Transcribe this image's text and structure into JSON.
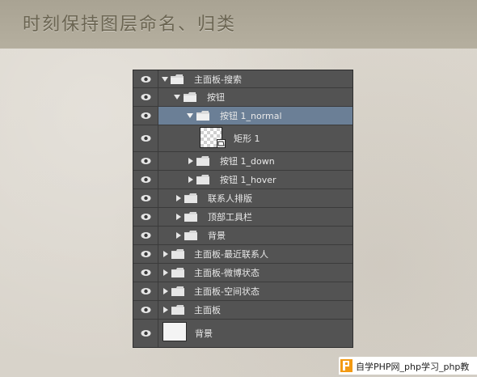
{
  "header": {
    "title": "时刻保持图层命名、归类"
  },
  "layers_panel": {
    "rows": [
      {
        "label": "主面板-搜索",
        "expanded": true,
        "type": "group"
      },
      {
        "label": "按钮",
        "expanded": true,
        "type": "group"
      },
      {
        "label": "按钮 1_normal",
        "expanded": true,
        "type": "group",
        "selected": true
      },
      {
        "label": "矩形 1",
        "type": "vector-shape-layer"
      },
      {
        "label": "按钮 1_down",
        "expanded": false,
        "type": "group"
      },
      {
        "label": "按钮 1_hover",
        "expanded": false,
        "type": "group"
      },
      {
        "label": "联系人排版",
        "expanded": false,
        "type": "group"
      },
      {
        "label": "顶部工具栏",
        "expanded": false,
        "type": "group"
      },
      {
        "label": "背景",
        "expanded": false,
        "type": "group"
      },
      {
        "label": "主面板-最近联系人",
        "expanded": false,
        "type": "group"
      },
      {
        "label": "主面板-微博状态",
        "expanded": false,
        "type": "group"
      },
      {
        "label": "主面板-空间状态",
        "expanded": false,
        "type": "group"
      },
      {
        "label": "主面板",
        "expanded": false,
        "type": "group"
      },
      {
        "label": "背景",
        "type": "fill-layer"
      }
    ]
  },
  "watermark": {
    "text": "自学PHP网_php学习_php教"
  },
  "colors": {
    "panel_bg": "#535353",
    "selected_row": "#6b7f96",
    "header_bg": "#aea898",
    "watermark_logo": "#f39a13"
  },
  "icons": {
    "visibility": "eye-icon",
    "expand_open": "triangle-down-icon",
    "expand_closed": "triangle-right-icon",
    "group": "folder-icon",
    "vector_mask": "vector-mask-icon"
  }
}
